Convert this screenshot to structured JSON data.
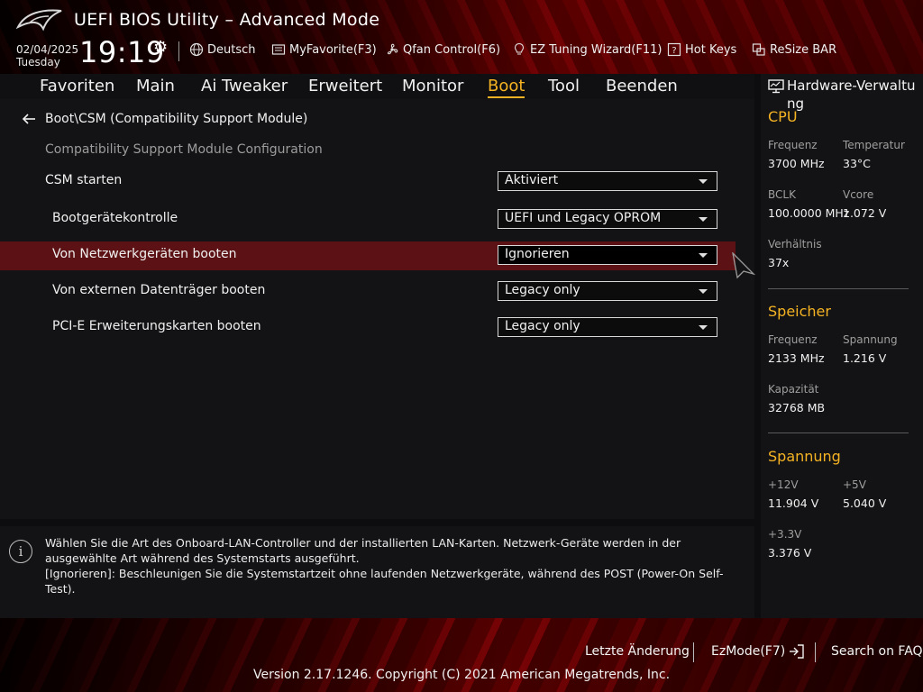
{
  "header": {
    "title": "UEFI BIOS Utility – Advanced Mode",
    "date": "02/04/2025",
    "day": "Tuesday",
    "time": "19:19",
    "items": [
      {
        "label": "Deutsch",
        "icon": "globe-icon"
      },
      {
        "label": "MyFavorite(F3)",
        "icon": "favorite-icon"
      },
      {
        "label": "Qfan Control(F6)",
        "icon": "fan-icon"
      },
      {
        "label": "EZ Tuning Wizard(F11)",
        "icon": "lightbulb-icon"
      },
      {
        "label": "Hot Keys",
        "icon": "question-icon"
      },
      {
        "label": "ReSize BAR",
        "icon": "resize-bar-icon"
      }
    ]
  },
  "nav": {
    "tabs": [
      {
        "label": "Favoriten"
      },
      {
        "label": "Main"
      },
      {
        "label": "Ai Tweaker"
      },
      {
        "label": "Erweitert"
      },
      {
        "label": "Monitor"
      },
      {
        "label": "Boot",
        "active": true
      },
      {
        "label": "Tool"
      },
      {
        "label": "Beenden"
      }
    ]
  },
  "main": {
    "breadcrumb": "Boot\\CSM (Compatibility Support Module)",
    "section_title": "Compatibility Support Module Configuration",
    "settings": [
      {
        "label": "CSM starten",
        "value": "Aktiviert"
      },
      {
        "label": "Bootgerätekontrolle",
        "value": "UEFI und Legacy OPROM"
      },
      {
        "label": "Von Netzwerkgeräten booten",
        "value": "Ignorieren",
        "selected": true
      },
      {
        "label": "Von externen Datenträger booten",
        "value": "Legacy only"
      },
      {
        "label": "PCI-E Erweiterungskarten booten",
        "value": "Legacy only"
      }
    ]
  },
  "info": {
    "line1": "Wählen Sie die Art des Onboard-LAN-Controller und der installierten LAN-Karten. Netzwerk-Geräte werden in der ausgewählte Art während des Systemstarts ausgeführt.",
    "line2": "[Ignorieren]: Beschleunigen Sie die Systemstartzeit ohne laufenden Netzwerkgeräte, während des POST (Power-On Self-Test)."
  },
  "hardware": {
    "title": "Hardware-Verwaltung",
    "cpu": {
      "heading": "CPU",
      "freq_label": "Frequenz",
      "freq": "3700 MHz",
      "temp_label": "Temperatur",
      "temp": "33°C",
      "bclk_label": "BCLK",
      "bclk": "100.0000 MHz",
      "vcore_label": "Vcore",
      "vcore": "1.072 V",
      "ratio_label": "Verhältnis",
      "ratio": "37x"
    },
    "memory": {
      "heading": "Speicher",
      "freq_label": "Frequenz",
      "freq": "2133 MHz",
      "volt_label": "Spannung",
      "volt": "1.216 V",
      "cap_label": "Kapazität",
      "cap": "32768 MB"
    },
    "voltage": {
      "heading": "Spannung",
      "v12_label": "+12V",
      "v12": "11.904 V",
      "v5_label": "+5V",
      "v5": "5.040 V",
      "v33_label": "+3.3V",
      "v33": "3.376 V"
    }
  },
  "footer": {
    "last_change": "Letzte Änderung",
    "ezmode": "EzMode(F7)",
    "faq": "Search on FAQ",
    "copyright": "Version 2.17.1246. Copyright (C) 2021 American Megatrends, Inc."
  },
  "colors": {
    "accent": "#f5b323",
    "highlight_row": "#5c1214",
    "panel": "#131315"
  }
}
